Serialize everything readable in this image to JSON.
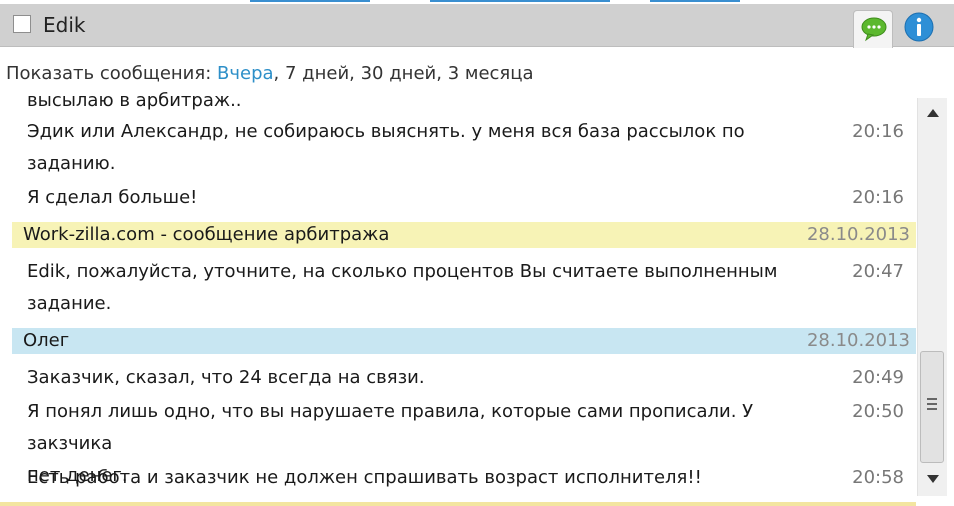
{
  "header": {
    "title": "Edik"
  },
  "filter": {
    "prefix": "Показать сообщения:",
    "options": [
      "Вчера",
      "7 дней",
      "30 дней",
      "3 месяца"
    ]
  },
  "messages": [
    {
      "text": "высылаю в арбитраж..",
      "time": ""
    },
    {
      "text": "Эдик или Александр, не собираюсь выяснять. у меня вся база рассылок по\nзаданию.",
      "time": "20:16"
    },
    {
      "text": "Я сделал больше!",
      "time": "20:16"
    },
    {
      "text": "Edik, пожалуйста, уточните, на сколько процентов Вы считаете выполненным\nзадание.",
      "time": "20:47"
    },
    {
      "text": "Заказчик, сказал, что 24 всегда на связи.",
      "time": "20:49"
    },
    {
      "text": "Я понял лишь одно, что вы нарушаете правила, которые сами прописали. У закзчика\nнет денег.",
      "time": "20:50"
    },
    {
      "text": "Есть работа и заказчик не должен спрашивать возраст исполнителя!!",
      "time": "20:58"
    }
  ],
  "senders": [
    {
      "name": "Work-zilla.com - сообщение арбитража",
      "date": "28.10.2013"
    },
    {
      "name": "Олег",
      "date": "28.10.2013"
    }
  ],
  "icons": {
    "chat_tab": "chat-bubble-icon",
    "info": "info-icon",
    "scroll_up": "arrow-up-icon",
    "scroll_down": "arrow-down-icon"
  },
  "colors": {
    "link": "#2d8fc8",
    "header_bg": "#d0d0d0",
    "arbitration_row": "#f7f3b6",
    "user_row": "#c8e6f2",
    "chat_icon": "#5cb82e",
    "info_icon": "#2e8fd6"
  }
}
